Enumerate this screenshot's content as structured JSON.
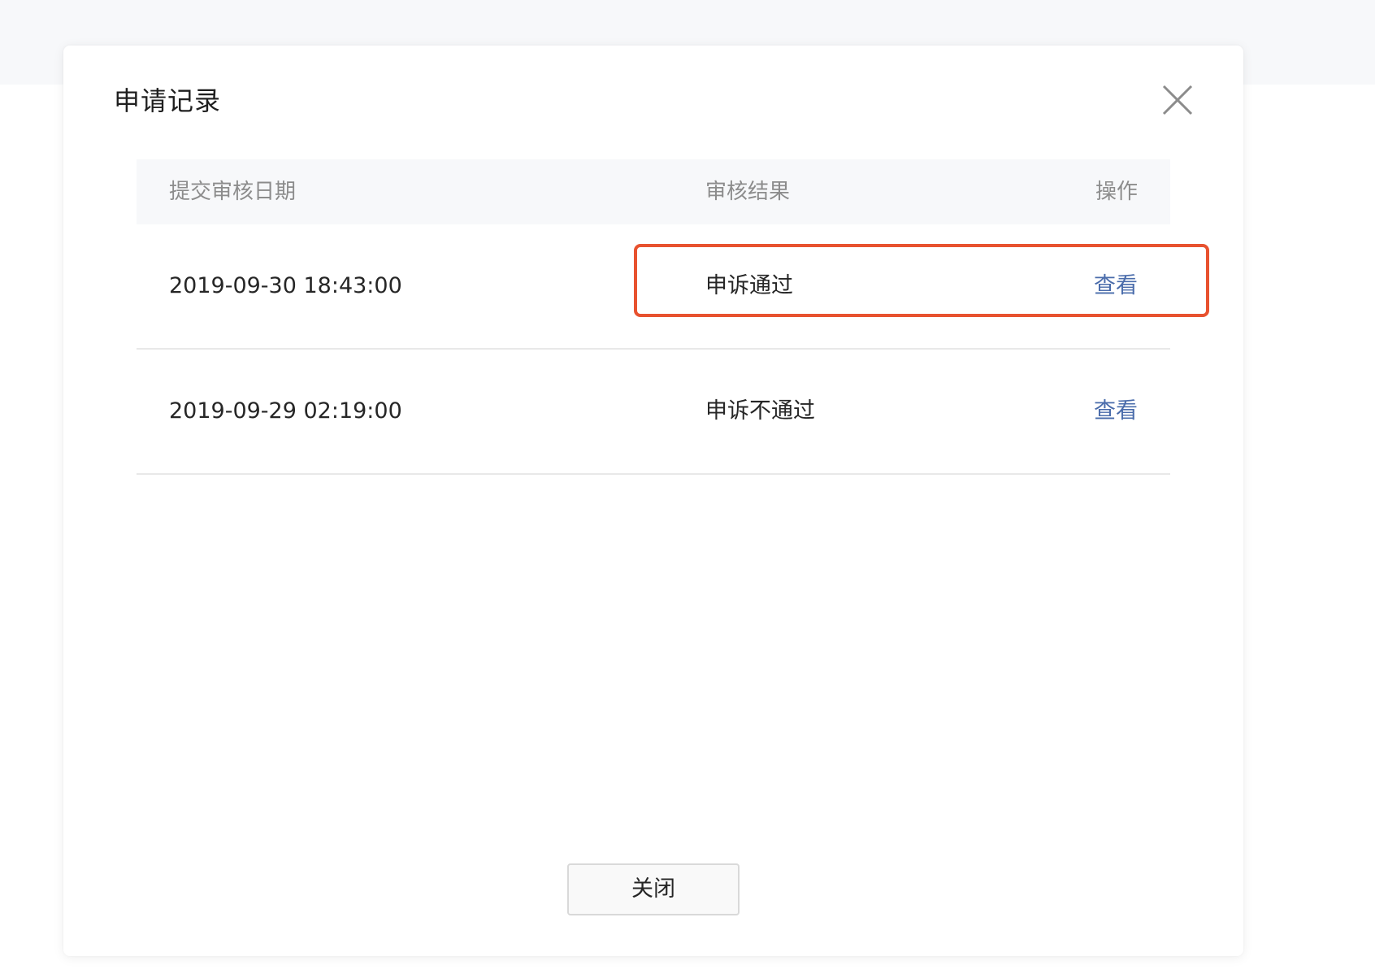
{
  "dialog": {
    "title": "申请记录",
    "close_icon": "close-icon",
    "close_button_label": "关闭"
  },
  "table": {
    "headers": {
      "date": "提交审核日期",
      "result": "审核结果",
      "action": "操作"
    },
    "rows": [
      {
        "date": "2019-09-30 18:43:00",
        "result": "申诉通过",
        "action": "查看",
        "highlighted": true
      },
      {
        "date": "2019-09-29 02:19:00",
        "result": "申诉不通过",
        "action": "查看",
        "highlighted": false
      }
    ]
  },
  "colors": {
    "link": "#4a6cab",
    "highlight_border": "#e8522f",
    "header_bg": "#f7f8fa"
  }
}
